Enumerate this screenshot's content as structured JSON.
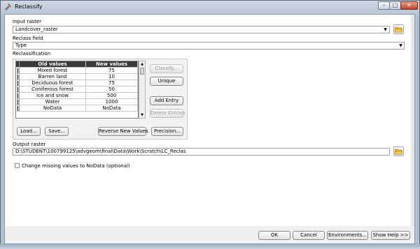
{
  "window": {
    "title": "Reclassify",
    "controls": {
      "minimize": "–",
      "maximize": "□",
      "close": "✕"
    }
  },
  "input_raster": {
    "label": "Input raster",
    "value": "Landcover_raster"
  },
  "reclass_field": {
    "label": "Reclass field",
    "value": "Type"
  },
  "reclassification": {
    "label": "Reclassification",
    "columns": [
      "Old values",
      "New values"
    ],
    "rows": [
      [
        "Mixed forest",
        "75"
      ],
      [
        "Barren land",
        "10"
      ],
      [
        "Deciduous forest",
        "75"
      ],
      [
        "Coniferous forest",
        "50"
      ],
      [
        "Ice and snow",
        "500"
      ],
      [
        "Water",
        "1000"
      ],
      [
        "NoData",
        "NoData"
      ]
    ],
    "side_buttons": {
      "classify": "Classify...",
      "unique": "Unique",
      "add_entry": "Add Entry",
      "delete_entries": "Delete Entries"
    },
    "bottom_buttons": {
      "load": "Load...",
      "save": "Save...",
      "reverse": "Reverse New Values",
      "precision": "Precision..."
    }
  },
  "output_raster": {
    "label": "Output raster",
    "value": "D:\\STUDENT\\100799125\\advgeom\\final\\Data\\Work\\Scratch\\LC_Reclas"
  },
  "change_missing": {
    "label": "Change missing values to NoData (optional)",
    "checked": false
  },
  "footer": {
    "ok": "OK",
    "cancel": "Cancel",
    "environments": "Environments...",
    "show_help": "Show Help >>"
  },
  "icons": {
    "title": "toolbox-icon",
    "folder": "open-folder-icon",
    "dropdown": "chevron-down-icon"
  },
  "colors": {
    "table_header": "#3a3a3a",
    "folder": "#e8b339"
  }
}
